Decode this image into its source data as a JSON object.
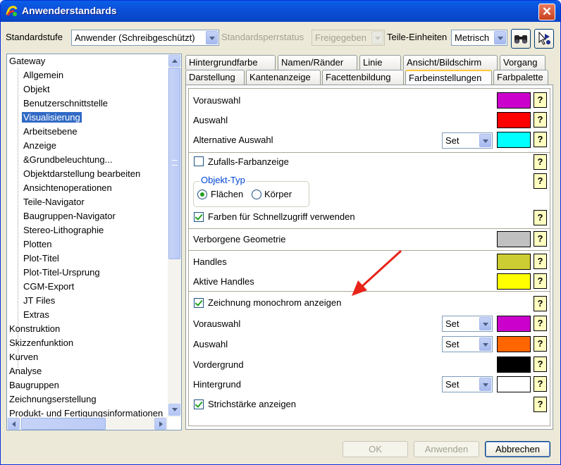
{
  "window": {
    "title": "Anwenderstandards",
    "close_label": "✕"
  },
  "toolbar": {
    "standardstufe_label": "Standardstufe",
    "standardstufe_value": "Anwender (Schreibgeschützt)",
    "sperrstatus_label": "Standardsperrstatus",
    "sperrstatus_value": "Freigegeben",
    "einheiten_label": "Teile-Einheiten",
    "einheiten_value": "Metrisch"
  },
  "tree": {
    "root": "Gateway",
    "children": [
      "Allgemein",
      "Objekt",
      "Benutzerschnittstelle",
      "Visualisierung",
      "Arbeitsebene",
      "Anzeige",
      "&Grundbeleuchtung...",
      "Objektdarstellung bearbeiten",
      "Ansichtenoperationen",
      "Teile-Navigator",
      "Baugruppen-Navigator",
      "Stereo-Lithographie",
      "Plotten",
      "Plot-Titel",
      "Plot-Titel-Ursprung",
      "CGM-Export",
      "JT Files",
      "Extras"
    ],
    "after": [
      "Konstruktion",
      "Skizzenfunktion",
      "Kurven",
      "Analyse",
      "Baugruppen",
      "Zeichnungserstellung",
      "Produkt- und Fertigungsinformationen"
    ],
    "selected": "Visualisierung"
  },
  "tabs": {
    "row1": [
      "Hintergrundfarbe",
      "Namen/Ränder",
      "Linie",
      "Ansicht/Bildschirm",
      "Vorgang"
    ],
    "row2": [
      "Darstellung",
      "Kantenanzeige",
      "Facettenbildung",
      "Farbeinstellungen",
      "Farbpalette"
    ],
    "active": "Farbeinstellungen"
  },
  "panel": {
    "vorauswahl": "Vorauswahl",
    "auswahl": "Auswahl",
    "alternative_auswahl": "Alternative Auswahl",
    "zufalls_farbanzeige": "Zufalls-Farbanzeige",
    "objekt_typ": "Objekt-Typ",
    "flaechen": "Flächen",
    "koerper": "Körper",
    "schnellzugriff": "Farben für Schnellzugriff verwenden",
    "verborgene_geometrie": "Verborgene Geometrie",
    "handles": "Handles",
    "aktive_handles": "Aktive Handles",
    "monochrom": "Zeichnung monochrom anzeigen",
    "mono_vorauswahl": "Vorauswahl",
    "mono_auswahl": "Auswahl",
    "vordergrund": "Vordergrund",
    "hintergrund": "Hintergrund",
    "strichstaerke": "Strichstärke anzeigen",
    "set_value": "Set",
    "help_glyph": "?"
  },
  "colors": {
    "vorauswahl": "#cc00cc",
    "auswahl": "#ff0000",
    "alternative_auswahl": "#00ffff",
    "verborgene_geometrie": "#c0c0c0",
    "handles": "#cccc33",
    "aktive_handles": "#ffff00",
    "mono_vorauswahl": "#cc00cc",
    "mono_auswahl": "#ff6600",
    "vordergrund": "#000000",
    "hintergrund": "#ffffff",
    "annotation_arrow": "#e8231a"
  },
  "buttons": {
    "ok": "OK",
    "anwenden": "Anwenden",
    "abbrechen": "Abbrechen"
  }
}
